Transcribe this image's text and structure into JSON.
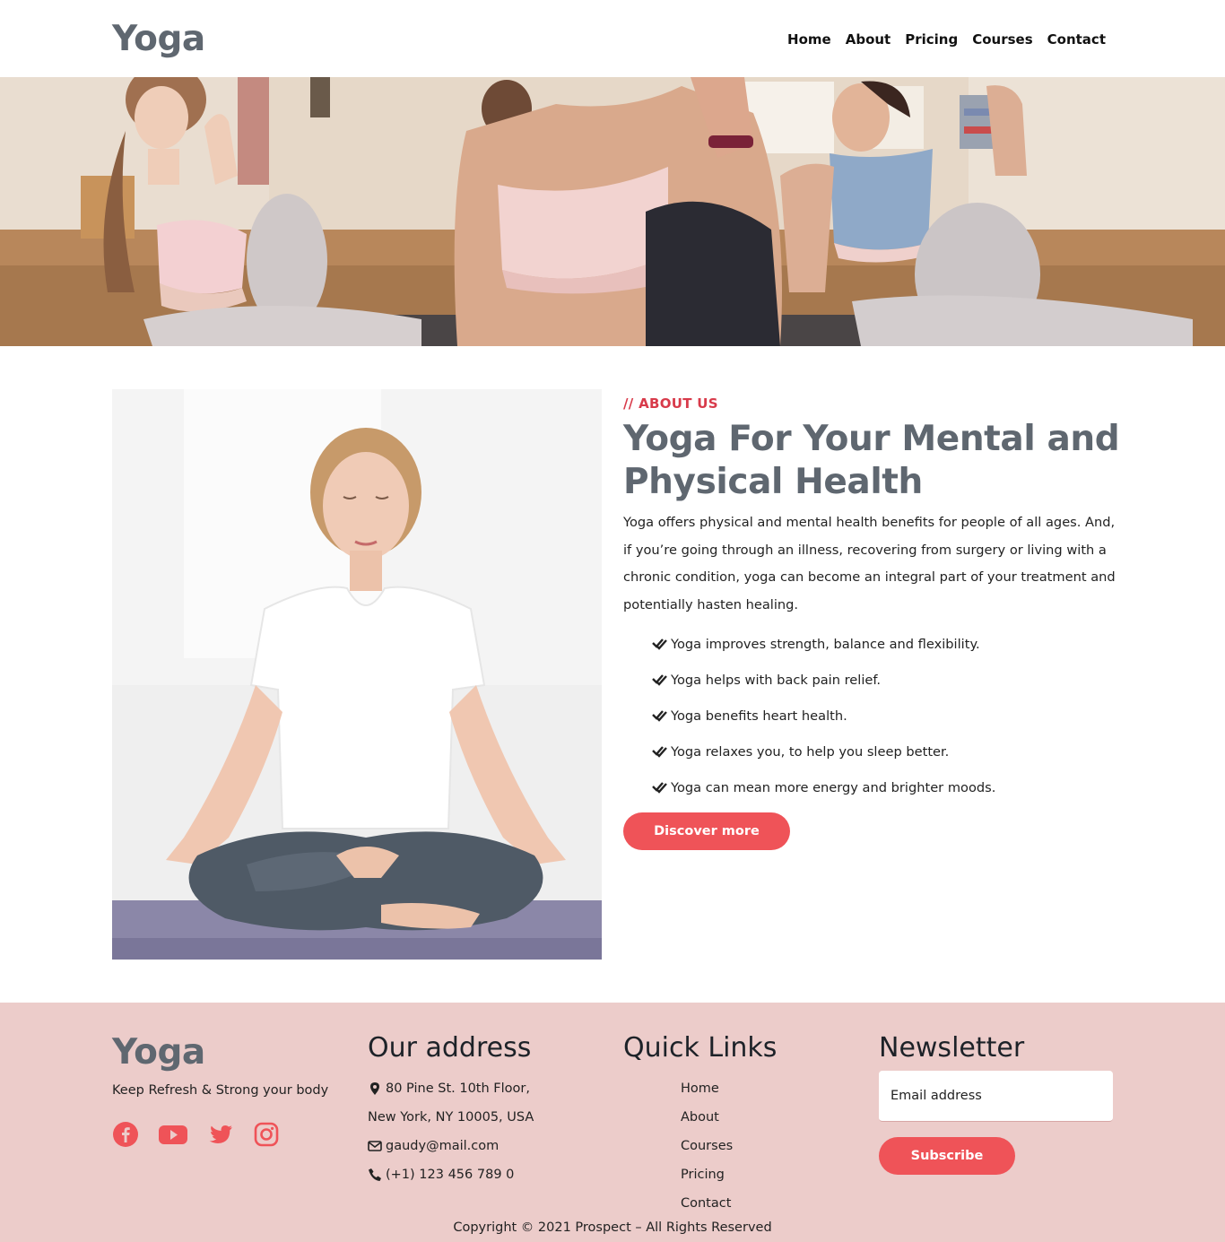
{
  "header": {
    "brand": "Yoga",
    "nav": [
      "Home",
      "About",
      "Pricing",
      "Courses",
      "Contact"
    ]
  },
  "hero": {
    "image": "yoga-class-photo"
  },
  "about": {
    "image": "meditating-woman-photo",
    "eyebrow": "// ABOUT US",
    "title": "Yoga For Your Mental and Physical Health",
    "text": "Yoga offers physical and mental health benefits for people of all ages. And, if you’re going through an illness, recovering from surgery or living with a chronic condition, yoga can become an integral part of your treatment and potentially hasten healing.",
    "checklist": [
      "Yoga improves strength, balance and flexibility.",
      "Yoga helps with back pain relief.",
      "Yoga benefits heart health.",
      "Yoga relaxes you, to help you sleep better.",
      "Yoga can mean more energy and brighter moods."
    ],
    "check_icon": "double-check-icon",
    "button": "Discover more"
  },
  "footer": {
    "brand": "Yoga",
    "tagline": "Keep Refresh & Strong your body",
    "socials": [
      "facebook-icon",
      "youtube-icon",
      "twitter-icon",
      "instagram-icon"
    ],
    "address": {
      "heading": "Our address",
      "line1": "80 Pine St. 10th Floor,",
      "line2": "New York, NY 10005, USA",
      "email": "gaudy@mail.com",
      "phone": "(+1) 123 456 789 0"
    },
    "quick_links": {
      "heading": "Quick Links",
      "items": [
        "Home",
        "About",
        "Courses",
        "Pricing",
        "Contact"
      ]
    },
    "newsletter": {
      "heading": "Newsletter",
      "placeholder": "Email address",
      "button": "Subscribe"
    },
    "copyright": "Copyright © 2021 Prospect – All Rights Reserved"
  },
  "colors": {
    "accent": "#ef5358",
    "eyebrow": "#d83a4a",
    "heading_gray": "#5f6770",
    "footer_bg": "#ecccca"
  }
}
